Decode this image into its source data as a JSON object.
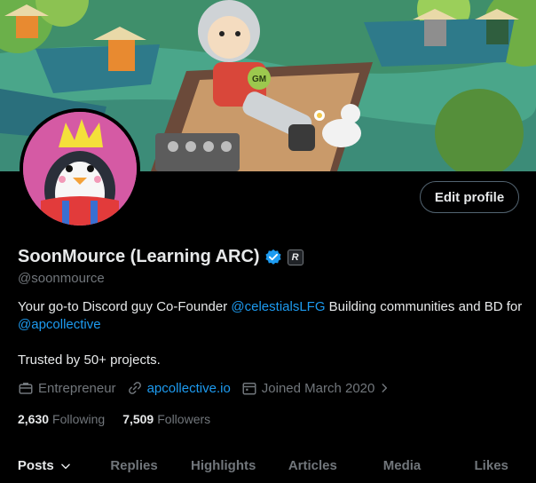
{
  "profile": {
    "name": "SoonMource (Learning ARC)",
    "handle": "@soonmource",
    "edit_label": "Edit profile",
    "affiliate_badge": "R",
    "bio": {
      "part1": "Your go-to Discord guy Co-Founder ",
      "mention1": "@celestialsLFG",
      "part2": " Building communities and BD for ",
      "mention2": "@apcollective",
      "line2": "Trusted by 50+ projects."
    },
    "meta": {
      "category": "Entrepreneur",
      "website": "apcollective.io",
      "joined": "Joined March 2020"
    },
    "stats": {
      "following_count": "2,630",
      "following_label": "Following",
      "followers_count": "7,509",
      "followers_label": "Followers"
    },
    "banner_text": "GM"
  },
  "tabs": [
    {
      "label": "Posts",
      "active": true
    },
    {
      "label": "Replies"
    },
    {
      "label": "Highlights"
    },
    {
      "label": "Articles"
    },
    {
      "label": "Media"
    },
    {
      "label": "Likes"
    }
  ],
  "colors": {
    "accent": "#1d9bf0",
    "background": "#000000",
    "muted": "#71767b"
  }
}
